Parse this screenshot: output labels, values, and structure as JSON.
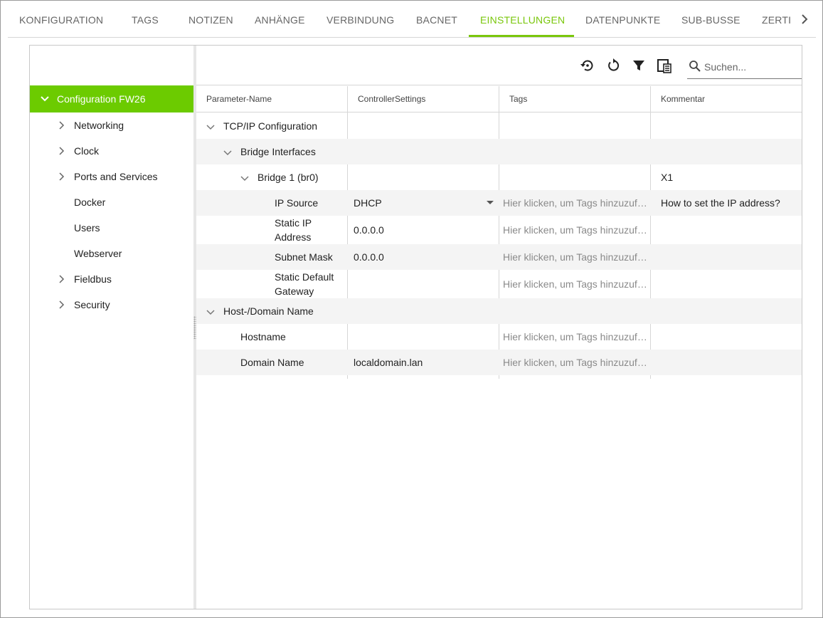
{
  "tabs": [
    {
      "label": "KONFIGURATION",
      "active": false
    },
    {
      "label": "TAGS",
      "active": false
    },
    {
      "label": "NOTIZEN",
      "active": false
    },
    {
      "label": "ANHÄNGE",
      "active": false
    },
    {
      "label": "VERBINDUNG",
      "active": false
    },
    {
      "label": "BACNET",
      "active": false
    },
    {
      "label": "EINSTELLUNGEN",
      "active": true
    },
    {
      "label": "DATENPUNKTE",
      "active": false
    },
    {
      "label": "SUB-BUSSE",
      "active": false
    },
    {
      "label": "ZERTI",
      "active": false
    }
  ],
  "colors": {
    "accent": "#6ccb00",
    "tab_active": "#7ac70c",
    "row_alt": "#f4f4f4"
  },
  "sidebar": {
    "root": {
      "label": "Configuration FW26",
      "expanded": true
    },
    "items": [
      {
        "label": "Networking",
        "has_children": true
      },
      {
        "label": "Clock",
        "has_children": true
      },
      {
        "label": "Ports and Services",
        "has_children": true
      },
      {
        "label": "Docker",
        "has_children": false
      },
      {
        "label": "Users",
        "has_children": false
      },
      {
        "label": "Webserver",
        "has_children": false
      },
      {
        "label": "Fieldbus",
        "has_children": true
      },
      {
        "label": "Security",
        "has_children": true
      }
    ]
  },
  "toolbar": {
    "icons": [
      "restore-icon",
      "reload-icon",
      "filter-icon",
      "column-chooser-icon"
    ],
    "search_placeholder": "Suchen..."
  },
  "table": {
    "columns": [
      "Parameter-Name",
      "ControllerSettings",
      "Tags",
      "Kommentar"
    ],
    "tags_placeholder": "Hier klicken, um Tags hinzuzufügen",
    "rows": [
      {
        "name": "TCP/IP Configuration",
        "level": 0,
        "expandable": true,
        "value": "",
        "tags": "",
        "comment": ""
      },
      {
        "name": "Bridge Interfaces",
        "level": 1,
        "expandable": true,
        "value": "",
        "tags": "",
        "comment": ""
      },
      {
        "name": "Bridge 1 (br0)",
        "level": 2,
        "expandable": true,
        "value": "",
        "tags": "",
        "comment": "X1"
      },
      {
        "name": "IP Source",
        "level": 3,
        "expandable": false,
        "value": "DHCP",
        "dropdown": true,
        "tags": "Hier klicken, um Tags hinzuzufügen",
        "comment": "How to set the IP address?"
      },
      {
        "name": "Static IP Address",
        "level": 3,
        "expandable": false,
        "value": "0.0.0.0",
        "tags": "Hier klicken, um Tags hinzuzufügen",
        "comment": ""
      },
      {
        "name": "Subnet Mask",
        "level": 3,
        "expandable": false,
        "value": "0.0.0.0",
        "tags": "Hier klicken, um Tags hinzuzufügen",
        "comment": ""
      },
      {
        "name": "Static Default Gateway",
        "level": 3,
        "expandable": false,
        "value": "",
        "tags": "Hier klicken, um Tags hinzuzufügen",
        "comment": ""
      },
      {
        "name": "Host-/Domain Name",
        "level": 0,
        "expandable": true,
        "value": "",
        "tags": "",
        "comment": ""
      },
      {
        "name": "Hostname",
        "level": 1,
        "expandable": false,
        "value": "",
        "tags": "Hier klicken, um Tags hinzuzufügen",
        "comment": ""
      },
      {
        "name": "Domain Name",
        "level": 1,
        "expandable": false,
        "value": "localdomain.lan",
        "tags": "Hier klicken, um Tags hinzuzufügen",
        "comment": ""
      }
    ]
  }
}
